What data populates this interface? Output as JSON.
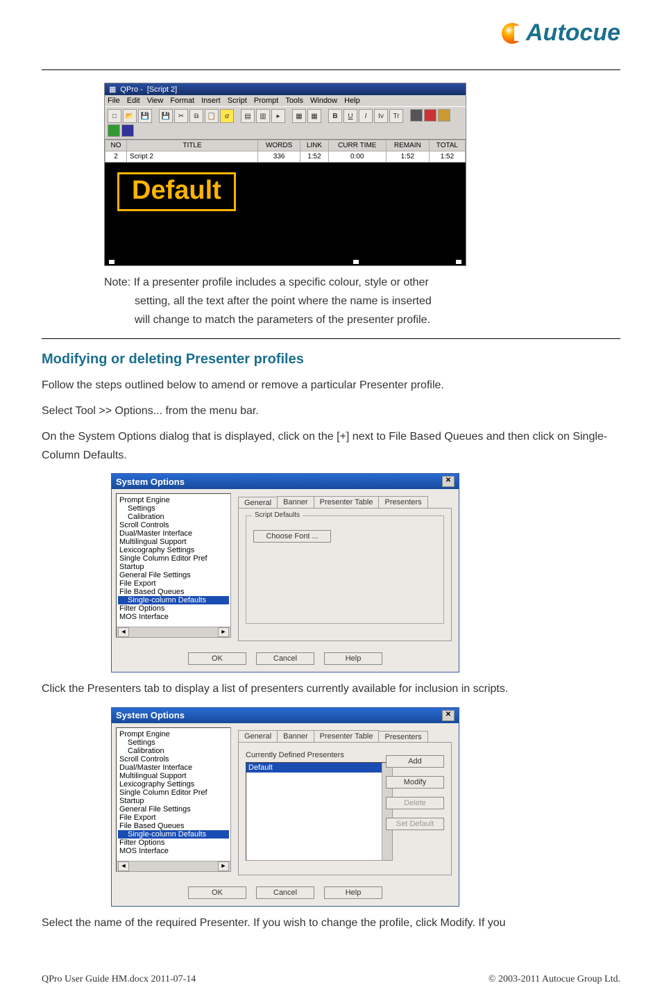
{
  "brand": {
    "name": "Autocue"
  },
  "qpro": {
    "title_prefix": "QPro - ",
    "title_doc": "[Script 2]",
    "menus": [
      "File",
      "Edit",
      "View",
      "Format",
      "Insert",
      "Script",
      "Prompt",
      "Tools",
      "Window",
      "Help"
    ],
    "columns": [
      "NO",
      "TITLE",
      "WORDS",
      "LINK",
      "CURR TIME",
      "REMAIN",
      "TOTAL"
    ],
    "row": {
      "no": "2",
      "title": "Script 2",
      "words": "336",
      "link": "1:52",
      "curr": "0:00",
      "remain": "1:52",
      "total": "1:52"
    },
    "stage_word": "Default"
  },
  "note": {
    "label": "Note:",
    "l1": "If a presenter profile includes a specific colour, style or other",
    "l2": "setting, all the text after the point where the name is inserted",
    "l3": "will change to match the parameters of the presenter profile."
  },
  "h2": "Modifying or deleting Presenter profiles",
  "p1": "Follow the steps outlined below to amend or remove a particular Presenter profile.",
  "p2": "Select Tool >> Options... from the menu bar.",
  "p3": "On the System Options dialog that is displayed, click on the [+] next to File Based Queues and then click on Single-Column Defaults.",
  "dlg": {
    "title": "System Options",
    "tree": {
      "items": [
        {
          "t": "Prompt Engine",
          "cls": ""
        },
        {
          "t": "Settings",
          "cls": "ind1"
        },
        {
          "t": "Calibration",
          "cls": "ind1"
        },
        {
          "t": "Scroll Controls",
          "cls": ""
        },
        {
          "t": "Dual/Master Interface",
          "cls": ""
        },
        {
          "t": "Multilingual Support",
          "cls": ""
        },
        {
          "t": "Lexicography Settings",
          "cls": ""
        },
        {
          "t": "Single Column Editor Pref",
          "cls": ""
        },
        {
          "t": "Startup",
          "cls": ""
        },
        {
          "t": "General File Settings",
          "cls": ""
        },
        {
          "t": "File Export",
          "cls": ""
        },
        {
          "t": "File Based Queues",
          "cls": ""
        },
        {
          "t": "Single-column Defaults",
          "cls": "ind1 sel"
        },
        {
          "t": "Filter Options",
          "cls": ""
        },
        {
          "t": "MOS Interface",
          "cls": ""
        }
      ]
    },
    "tabs1": [
      "General",
      "Banner",
      "Presenter Table",
      "Presenters"
    ],
    "group_title": "Script Defaults",
    "choose_font": "Choose Font ...",
    "buttons": {
      "ok": "OK",
      "cancel": "Cancel",
      "help": "Help"
    }
  },
  "p4": "Click the Presenters tab to display a list of presenters currently available for inclusion in scripts.",
  "dlg2": {
    "cdp_label": "Currently Defined Presenters",
    "list_selected": "Default",
    "side": {
      "add": "Add",
      "modify": "Modify",
      "delete": "Delete",
      "setdef": "Set Default"
    }
  },
  "p5": "Select the name of the required Presenter. If you wish to change the profile, click Modify. If you",
  "footer": {
    "left": "QPro User Guide HM.docx    2011-07-14",
    "right": "© 2003-2011 Autocue Group Ltd."
  }
}
